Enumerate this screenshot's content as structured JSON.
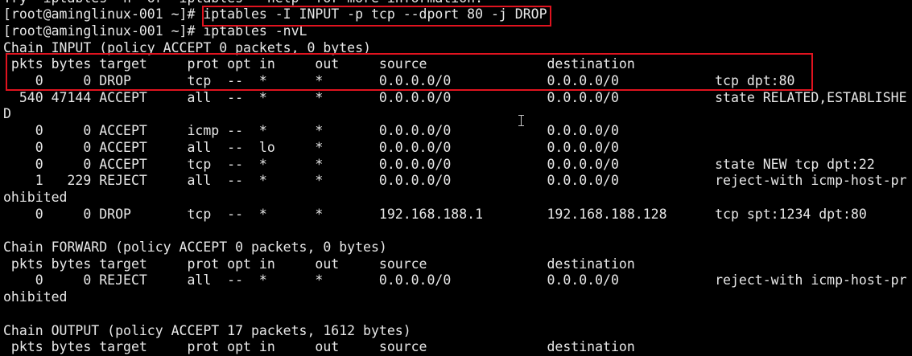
{
  "terminal": {
    "lines": [
      "Try `iptables -h' or 'iptables --help' for more information.",
      "[root@aminglinux-001 ~]# iptables -I INPUT -p tcp --dport 80 -j DROP",
      "[root@aminglinux-001 ~]# iptables -nvL",
      "Chain INPUT (policy ACCEPT 0 packets, 0 bytes)",
      " pkts bytes target     prot opt in     out     source               destination",
      "    0     0 DROP       tcp  --  *      *       0.0.0.0/0            0.0.0.0/0            tcp dpt:80",
      "  540 47144 ACCEPT     all  --  *      *       0.0.0.0/0            0.0.0.0/0            state RELATED,ESTABLISHE",
      "D",
      "    0     0 ACCEPT     icmp --  *      *       0.0.0.0/0            0.0.0.0/0",
      "    0     0 ACCEPT     all  --  lo     *       0.0.0.0/0            0.0.0.0/0",
      "    0     0 ACCEPT     tcp  --  *      *       0.0.0.0/0            0.0.0.0/0            state NEW tcp dpt:22",
      "    1   229 REJECT     all  --  *      *       0.0.0.0/0            0.0.0.0/0            reject-with icmp-host-pr",
      "ohibited",
      "    0     0 DROP       tcp  --  *      *       192.168.188.1        192.168.188.128      tcp spt:1234 dpt:80",
      "",
      "Chain FORWARD (policy ACCEPT 0 packets, 0 bytes)",
      " pkts bytes target     prot opt in     out     source               destination",
      "    0     0 REJECT     all  --  *      *       0.0.0.0/0            0.0.0.0/0            reject-with icmp-host-pr",
      "ohibited",
      "",
      "Chain OUTPUT (policy ACCEPT 17 packets, 1612 bytes)",
      " pkts bytes target     prot opt in     out     source               destination"
    ]
  },
  "colors": {
    "background": "#000000",
    "text": "#e8e8e8",
    "highlight_box": "#e0131f",
    "cursor": "#c8c8c8"
  },
  "icons": {
    "text_cursor": "i-beam-cursor-icon"
  }
}
